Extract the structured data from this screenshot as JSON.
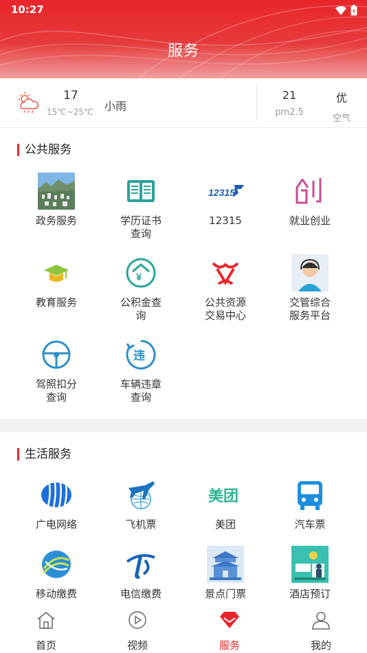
{
  "status_bar": {
    "time": "10:27"
  },
  "header": {
    "title": "服务"
  },
  "weather": {
    "temp": "17",
    "range": "15℃~25℃",
    "desc": "小雨",
    "pm_value": "21",
    "pm_label": "pm2.5",
    "aq_value": "优",
    "aq_label": "空气"
  },
  "public_services": {
    "title": "公共服务",
    "items": [
      {
        "label": "政务服务",
        "icon": "city-photo-icon"
      },
      {
        "label": "学历证书\n查询",
        "icon": "certificate-book-icon"
      },
      {
        "label": "12315",
        "icon": "12315-logo-icon"
      },
      {
        "label": "就业创业",
        "icon": "chuang-logo-icon"
      },
      {
        "label": "教育服务",
        "icon": "graduation-cap-icon"
      },
      {
        "label": "公积金查\n询",
        "icon": "housing-fund-icon"
      },
      {
        "label": "公共资源\n交易中心",
        "icon": "resource-exchange-icon"
      },
      {
        "label": "交管综合\n服务平台",
        "icon": "customer-service-icon"
      },
      {
        "label": "驾照扣分\n查询",
        "icon": "steering-wheel-icon"
      },
      {
        "label": "车辆违章\n查询",
        "icon": "violation-icon"
      }
    ]
  },
  "life_services": {
    "title": "生活服务",
    "items": [
      {
        "label": "广电网络",
        "icon": "broadcast-network-icon"
      },
      {
        "label": "飞机票",
        "icon": "airplane-icon"
      },
      {
        "label": "美团",
        "icon": "meituan-icon"
      },
      {
        "label": "汽车票",
        "icon": "bus-icon"
      },
      {
        "label": "移动缴费",
        "icon": "china-mobile-icon"
      },
      {
        "label": "电信缴费",
        "icon": "china-telecom-icon"
      },
      {
        "label": "景点门票",
        "icon": "scenic-gate-icon"
      },
      {
        "label": "酒店预订",
        "icon": "hotel-icon"
      }
    ]
  },
  "nav": {
    "items": [
      {
        "label": "首页",
        "icon": "home-icon"
      },
      {
        "label": "视频",
        "icon": "video-icon"
      },
      {
        "label": "服务",
        "icon": "service-gem-icon"
      },
      {
        "label": "我的",
        "icon": "profile-icon"
      }
    ],
    "active": "服务"
  },
  "colors": {
    "brand_red": "#e8262b",
    "teal": "#2aa39a",
    "blue": "#1e6fd9"
  }
}
